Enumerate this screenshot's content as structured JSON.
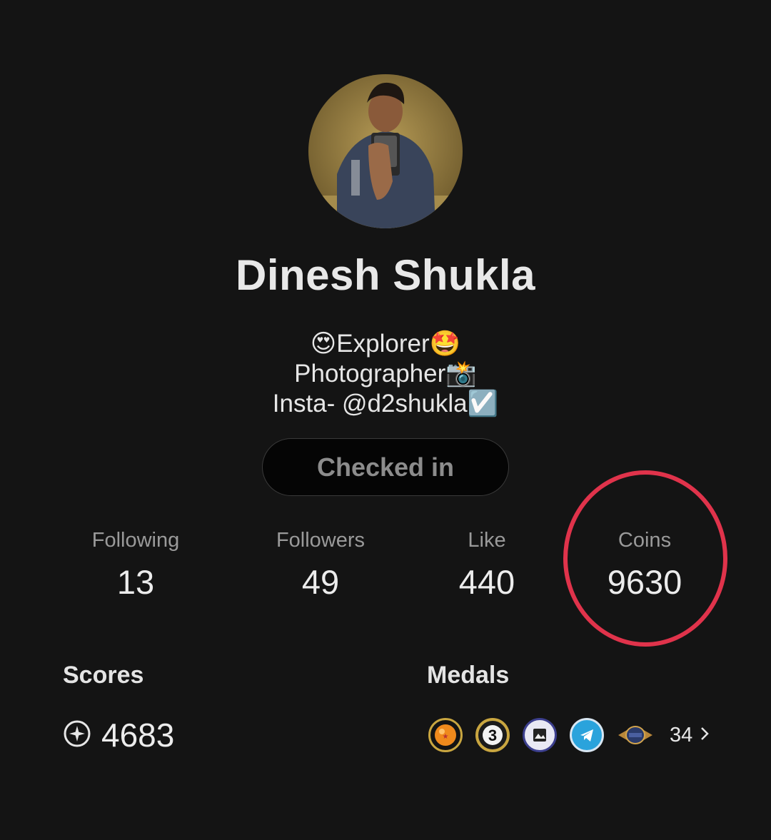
{
  "profile": {
    "name": "Dinesh Shukla",
    "bio": [
      "😍Explorer🤩",
      "Photographer📸",
      "Insta- @d2shukla☑️"
    ],
    "checkin_label": "Checked in"
  },
  "stats": [
    {
      "label": "Following",
      "value": "13"
    },
    {
      "label": "Followers",
      "value": "49"
    },
    {
      "label": "Like",
      "value": "440"
    },
    {
      "label": "Coins",
      "value": "9630"
    }
  ],
  "scores": {
    "title": "Scores",
    "value": "4683",
    "icon": "score-compass-icon"
  },
  "medals": {
    "title": "Medals",
    "count": "34",
    "icons": [
      "dragon-ball-medal",
      "number-3-medal",
      "photo-medal",
      "telegram-medal",
      "winged-badge-medal"
    ]
  },
  "colors": {
    "background": "#141414",
    "highlight_circle": "#e0334b"
  }
}
